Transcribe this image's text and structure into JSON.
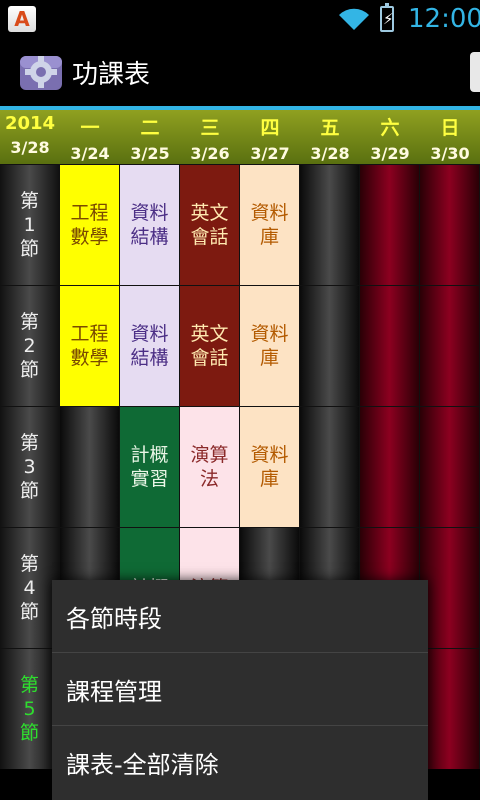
{
  "status": {
    "app_badge": "A",
    "time": "12:00"
  },
  "app": {
    "title": "功課表"
  },
  "header": {
    "year": "2014",
    "today": "3/28",
    "days": [
      {
        "label": "一",
        "date": "3/24"
      },
      {
        "label": "二",
        "date": "3/25"
      },
      {
        "label": "三",
        "date": "3/26"
      },
      {
        "label": "四",
        "date": "3/27"
      },
      {
        "label": "五",
        "date": "3/28"
      },
      {
        "label": "六",
        "date": "3/29"
      },
      {
        "label": "日",
        "date": "3/30"
      }
    ]
  },
  "periods": [
    {
      "line1": "第",
      "line2": "1",
      "line3": "節",
      "cells": [
        "工程\n數學",
        "資料\n結構",
        "英文\n會話",
        "資料\n庫",
        "",
        "",
        ""
      ]
    },
    {
      "line1": "第",
      "line2": "2",
      "line3": "節",
      "cells": [
        "工程\n數學",
        "資料\n結構",
        "英文\n會話",
        "資料\n庫",
        "",
        "",
        ""
      ]
    },
    {
      "line1": "第",
      "line2": "3",
      "line3": "節",
      "cells": [
        "",
        "計概\n實習",
        "演算\n法",
        "資料\n庫",
        "",
        "",
        ""
      ]
    },
    {
      "line1": "第",
      "line2": "4",
      "line3": "節",
      "cells": [
        "",
        "計概",
        "演算",
        "",
        "",
        "",
        ""
      ]
    },
    {
      "line1": "第",
      "line2": "5",
      "line3": "節",
      "cells": [
        "",
        "",
        "",
        "",
        "",
        "",
        ""
      ]
    }
  ],
  "menu": {
    "items": [
      "各節時段",
      "課程管理",
      "課表-全部清除"
    ]
  },
  "colors": {
    "accent": "#33b5e5",
    "header_text": "#ffff40",
    "weekend": "#8c0020",
    "current_period": "#2ede2e"
  }
}
